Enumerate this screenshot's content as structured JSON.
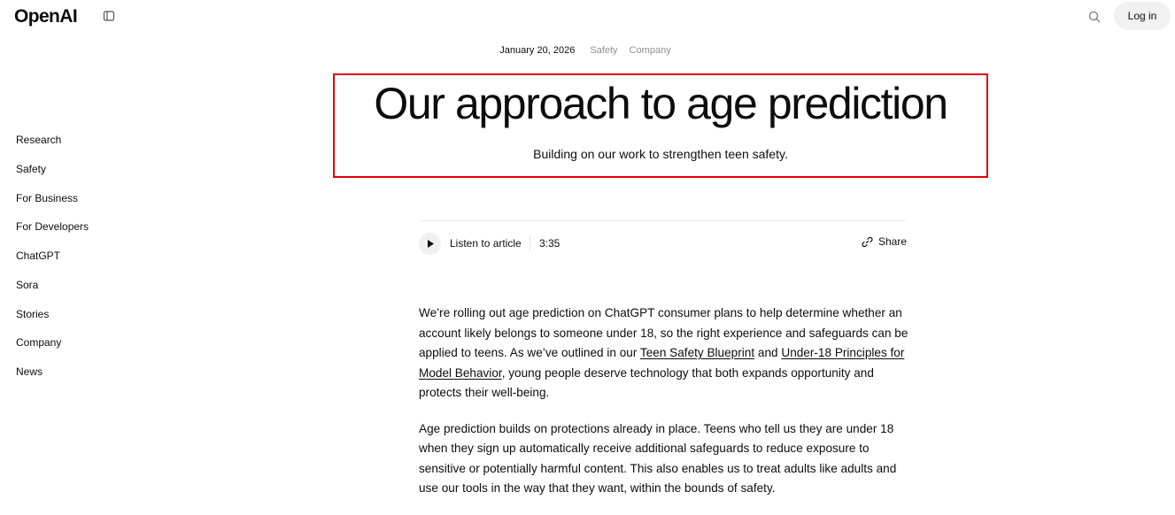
{
  "header": {
    "logo": "OpenAI",
    "login_label": "Log in",
    "icons": [
      "sidebar-toggle-icon",
      "search-icon"
    ]
  },
  "sidebar": {
    "items": [
      {
        "label": "Research"
      },
      {
        "label": "Safety"
      },
      {
        "label": "For Business"
      },
      {
        "label": "For Developers"
      },
      {
        "label": "ChatGPT"
      },
      {
        "label": "Sora"
      },
      {
        "label": "Stories"
      },
      {
        "label": "Company"
      },
      {
        "label": "News"
      }
    ]
  },
  "article": {
    "date": "January 20, 2026",
    "tags": [
      "Safety",
      "Company"
    ],
    "title": "Our approach to age prediction",
    "subtitle": "Building on our work to strengthen teen safety.",
    "player": {
      "listen_label": "Listen to article",
      "duration": "3:35",
      "share_label": "Share"
    },
    "p1": {
      "t1": "We’re rolling out age prediction on ChatGPT consumer plans to help determine whether an account likely belongs to someone under 18, so the right experience and safeguards can be applied to teens. As we’ve outlined in our ",
      "link1": "Teen Safety Blueprint",
      "t2": " and ",
      "link2": "Under-18 Principles for Model Behavior",
      "t3": ", young people deserve technology that both expands opportunity and protects their well-being."
    },
    "p2": "Age prediction builds on protections already in place. Teens who tell us they are under 18 when they sign up automatically receive additional safeguards to reduce exposure to sensitive or potentially harmful content. This also enables us to treat adults like adults and use our tools in the way that they want, within the bounds of safety."
  },
  "colors": {
    "highlight_border": "#e00000",
    "tag_gray": "#8f8f8f",
    "button_bg": "#f1f1f1"
  }
}
